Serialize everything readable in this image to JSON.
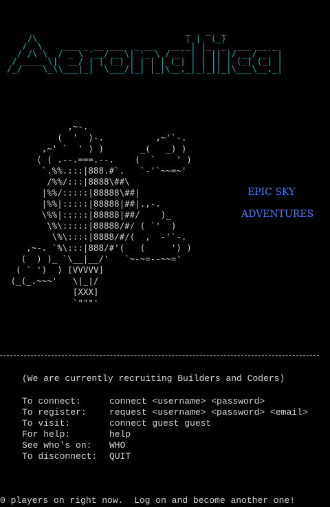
{
  "title_art": "                                   _   _  _\n    /\\                             | |  (_)\n   /  \\    ___ _ __ ___  _ __   __ _| |_  _  ___ __ _\n  / /\\ \\  / _ \\ '__/ _ \\| '_ \\ / _` | | || |/ __/ _` |\n / ____ \\|  __/ | | (_) | | | | (_| | | || | (_| (_| |\n/_/    \\_\\\\___|_|  \\___/|_| |_|\\__,_|_|_||_|\\___\\__,_|",
  "ship_art": "            ,~-.\n          (  '  )-.          ,~'`-.\n       ,~' `  ' ) )       _(   _) )\n      ( ( .--.===.--.    (  `    ' )\n       `.%%.:::|888.#`.   `-'`~~=~'\n        /%%/:::|8888\\##\\\n       |%%/:::::|88888\\##|        \n       |%%|:::::|88888|##|.,-.\n       \\%%|:::::|88888|##/    )_\n        \\%\\:::::|88888/#/ ( `'  )\n         \\%\\::::|8888/#/(  ,  -'`-.\n    ,~-. `%\\:::|888/#'(   (     ') )\n   (  ) )_ `\\__|__/'   `~-~=--~~='\n  ( ` ')  ) [VVVVV]\n (_(_.~~~'   \\|_|/\n             [XXX]\n             `\"\"\"'",
  "taglines": [
    "EPIC SKY",
    "ADVENTURES"
  ],
  "divider": "----------------------------------------------------------------------------",
  "recruit_line": "(We are currently recruiting Builders and Coders)",
  "commands": [
    {
      "label": "To connect:",
      "value": "connect <username> <password>"
    },
    {
      "label": "To register:",
      "value": "request <username> <password> <email>"
    },
    {
      "label": "To visit:",
      "value": "connect guest guest"
    },
    {
      "label": "For help:",
      "value": "help"
    },
    {
      "label": "See who's on:",
      "value": "WHO"
    },
    {
      "label": "To disconnect:",
      "value": "QUIT"
    }
  ],
  "footer_line": "0 players on right now.  Log on and become another one!",
  "colors": {
    "background": "#000000",
    "text": "#d6d6d6",
    "logo": "#1fb3b3",
    "tagline": "#4a7dff"
  }
}
